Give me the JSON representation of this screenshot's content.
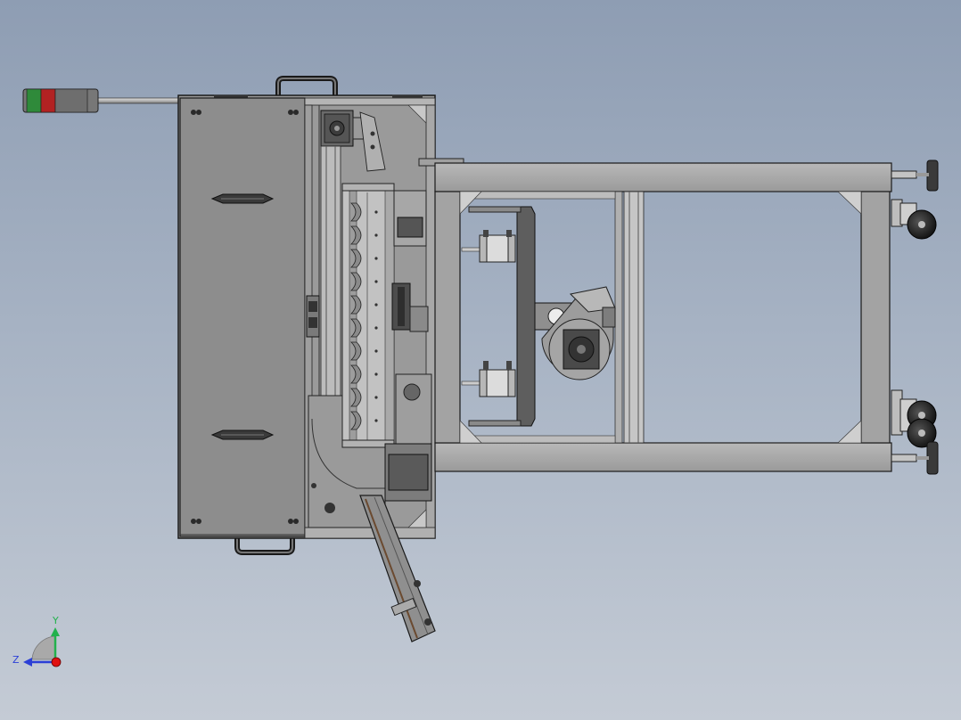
{
  "viewport": {
    "background_top": "#8e9db3",
    "background_bottom": "#c4cbd5"
  },
  "model": {
    "stack_light_colors": [
      "#2f8a3a",
      "#b22222",
      "#707070"
    ],
    "frame_color": "#a9a9a9",
    "panel_color": "#8d8d8d",
    "outline_color": "#1a1a1a"
  },
  "triad": {
    "y_label": "Y",
    "z_label": "Z",
    "y_color": "#22b14c",
    "z_color": "#2b3fd6",
    "x_color": "#e01010"
  }
}
